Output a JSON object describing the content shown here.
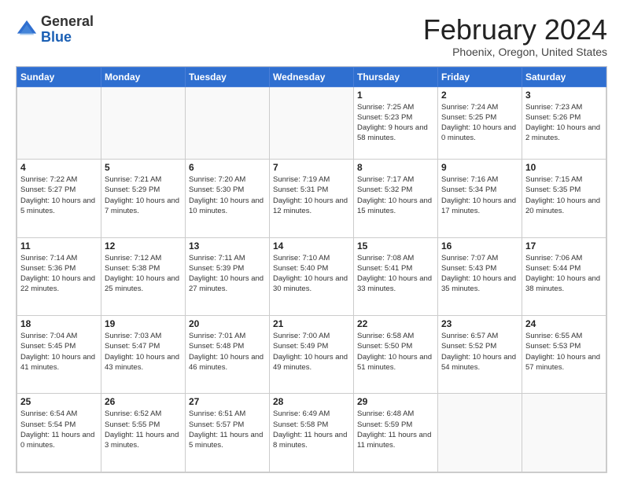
{
  "header": {
    "logo_general": "General",
    "logo_blue": "Blue",
    "month_title": "February 2024",
    "location": "Phoenix, Oregon, United States"
  },
  "weekdays": [
    "Sunday",
    "Monday",
    "Tuesday",
    "Wednesday",
    "Thursday",
    "Friday",
    "Saturday"
  ],
  "rows": [
    {
      "cells": [
        {
          "empty": true
        },
        {
          "empty": true
        },
        {
          "empty": true
        },
        {
          "empty": true
        },
        {
          "day": "1",
          "sunrise": "7:25 AM",
          "sunset": "5:23 PM",
          "daylight": "9 hours and 58 minutes."
        },
        {
          "day": "2",
          "sunrise": "7:24 AM",
          "sunset": "5:25 PM",
          "daylight": "10 hours and 0 minutes."
        },
        {
          "day": "3",
          "sunrise": "7:23 AM",
          "sunset": "5:26 PM",
          "daylight": "10 hours and 2 minutes."
        }
      ]
    },
    {
      "cells": [
        {
          "day": "4",
          "sunrise": "7:22 AM",
          "sunset": "5:27 PM",
          "daylight": "10 hours and 5 minutes."
        },
        {
          "day": "5",
          "sunrise": "7:21 AM",
          "sunset": "5:29 PM",
          "daylight": "10 hours and 7 minutes."
        },
        {
          "day": "6",
          "sunrise": "7:20 AM",
          "sunset": "5:30 PM",
          "daylight": "10 hours and 10 minutes."
        },
        {
          "day": "7",
          "sunrise": "7:19 AM",
          "sunset": "5:31 PM",
          "daylight": "10 hours and 12 minutes."
        },
        {
          "day": "8",
          "sunrise": "7:17 AM",
          "sunset": "5:32 PM",
          "daylight": "10 hours and 15 minutes."
        },
        {
          "day": "9",
          "sunrise": "7:16 AM",
          "sunset": "5:34 PM",
          "daylight": "10 hours and 17 minutes."
        },
        {
          "day": "10",
          "sunrise": "7:15 AM",
          "sunset": "5:35 PM",
          "daylight": "10 hours and 20 minutes."
        }
      ]
    },
    {
      "cells": [
        {
          "day": "11",
          "sunrise": "7:14 AM",
          "sunset": "5:36 PM",
          "daylight": "10 hours and 22 minutes."
        },
        {
          "day": "12",
          "sunrise": "7:12 AM",
          "sunset": "5:38 PM",
          "daylight": "10 hours and 25 minutes."
        },
        {
          "day": "13",
          "sunrise": "7:11 AM",
          "sunset": "5:39 PM",
          "daylight": "10 hours and 27 minutes."
        },
        {
          "day": "14",
          "sunrise": "7:10 AM",
          "sunset": "5:40 PM",
          "daylight": "10 hours and 30 minutes."
        },
        {
          "day": "15",
          "sunrise": "7:08 AM",
          "sunset": "5:41 PM",
          "daylight": "10 hours and 33 minutes."
        },
        {
          "day": "16",
          "sunrise": "7:07 AM",
          "sunset": "5:43 PM",
          "daylight": "10 hours and 35 minutes."
        },
        {
          "day": "17",
          "sunrise": "7:06 AM",
          "sunset": "5:44 PM",
          "daylight": "10 hours and 38 minutes."
        }
      ]
    },
    {
      "cells": [
        {
          "day": "18",
          "sunrise": "7:04 AM",
          "sunset": "5:45 PM",
          "daylight": "10 hours and 41 minutes."
        },
        {
          "day": "19",
          "sunrise": "7:03 AM",
          "sunset": "5:47 PM",
          "daylight": "10 hours and 43 minutes."
        },
        {
          "day": "20",
          "sunrise": "7:01 AM",
          "sunset": "5:48 PM",
          "daylight": "10 hours and 46 minutes."
        },
        {
          "day": "21",
          "sunrise": "7:00 AM",
          "sunset": "5:49 PM",
          "daylight": "10 hours and 49 minutes."
        },
        {
          "day": "22",
          "sunrise": "6:58 AM",
          "sunset": "5:50 PM",
          "daylight": "10 hours and 51 minutes."
        },
        {
          "day": "23",
          "sunrise": "6:57 AM",
          "sunset": "5:52 PM",
          "daylight": "10 hours and 54 minutes."
        },
        {
          "day": "24",
          "sunrise": "6:55 AM",
          "sunset": "5:53 PM",
          "daylight": "10 hours and 57 minutes."
        }
      ]
    },
    {
      "cells": [
        {
          "day": "25",
          "sunrise": "6:54 AM",
          "sunset": "5:54 PM",
          "daylight": "11 hours and 0 minutes."
        },
        {
          "day": "26",
          "sunrise": "6:52 AM",
          "sunset": "5:55 PM",
          "daylight": "11 hours and 3 minutes."
        },
        {
          "day": "27",
          "sunrise": "6:51 AM",
          "sunset": "5:57 PM",
          "daylight": "11 hours and 5 minutes."
        },
        {
          "day": "28",
          "sunrise": "6:49 AM",
          "sunset": "5:58 PM",
          "daylight": "11 hours and 8 minutes."
        },
        {
          "day": "29",
          "sunrise": "6:48 AM",
          "sunset": "5:59 PM",
          "daylight": "11 hours and 11 minutes."
        },
        {
          "empty": true
        },
        {
          "empty": true
        }
      ]
    }
  ]
}
